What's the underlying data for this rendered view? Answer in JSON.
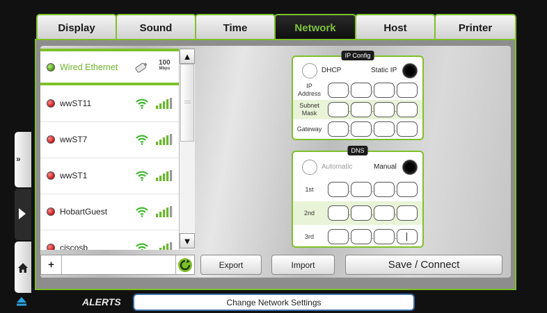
{
  "tabs": [
    {
      "label": "Display",
      "active": false
    },
    {
      "label": "Sound",
      "active": false
    },
    {
      "label": "Time",
      "active": false
    },
    {
      "label": "Network",
      "active": true
    },
    {
      "label": "Host",
      "active": false
    },
    {
      "label": "Printer",
      "active": false
    }
  ],
  "networks": [
    {
      "name": "Wired Ethernet",
      "status": "connected",
      "type": "ethernet",
      "speed_value": "100",
      "speed_unit": "Mbps"
    },
    {
      "name": "wwST11",
      "status": "disconnected",
      "type": "wifi"
    },
    {
      "name": "wwST7",
      "status": "disconnected",
      "type": "wifi"
    },
    {
      "name": "wwST1",
      "status": "disconnected",
      "type": "wifi"
    },
    {
      "name": "HobartGuest",
      "status": "disconnected",
      "type": "wifi"
    },
    {
      "name": "ciscosb",
      "status": "disconnected",
      "type": "wifi"
    }
  ],
  "ip_config": {
    "title": "IP Config",
    "dhcp_label": "DHCP",
    "static_label": "Static IP",
    "selected": "Static IP",
    "fields": [
      {
        "label_line1": "IP",
        "label_line2": "Address"
      },
      {
        "label_line1": "Subnet",
        "label_line2": "Mask"
      },
      {
        "label_line1": "Gateway",
        "label_line2": ""
      }
    ]
  },
  "dns": {
    "title": "DNS",
    "automatic_label": "Automatic",
    "manual_label": "Manual",
    "selected": "Manual",
    "rows": [
      "1st",
      "2nd",
      "3rd"
    ]
  },
  "buttons": {
    "add": "+",
    "export": "Export",
    "import": "Import",
    "save": "Save / Connect"
  },
  "alerts": {
    "label": "ALERTS",
    "message": "Change Network Settings"
  },
  "colors": {
    "accent": "#7fbf2a",
    "connected": "#4f9b12",
    "disconnected": "#c41515",
    "alert_border": "#3d6ea8"
  },
  "icons": [
    "ethernet-plug-icon",
    "wifi-icon",
    "signal-bars-icon",
    "refresh-icon",
    "scroll-up-icon",
    "scroll-down-icon",
    "collapse-icon",
    "play-icon",
    "home-icon",
    "eject-icon"
  ]
}
